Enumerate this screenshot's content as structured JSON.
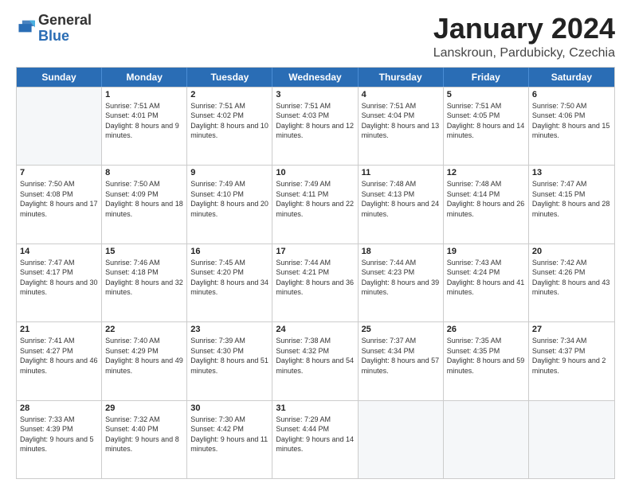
{
  "logo": {
    "general": "General",
    "blue": "Blue"
  },
  "header": {
    "title": "January 2024",
    "subtitle": "Lanskroun, Pardubicky, Czechia"
  },
  "weekdays": [
    "Sunday",
    "Monday",
    "Tuesday",
    "Wednesday",
    "Thursday",
    "Friday",
    "Saturday"
  ],
  "weeks": [
    [
      {
        "day": "",
        "sunrise": "",
        "sunset": "",
        "daylight": ""
      },
      {
        "day": "1",
        "sunrise": "Sunrise: 7:51 AM",
        "sunset": "Sunset: 4:01 PM",
        "daylight": "Daylight: 8 hours and 9 minutes."
      },
      {
        "day": "2",
        "sunrise": "Sunrise: 7:51 AM",
        "sunset": "Sunset: 4:02 PM",
        "daylight": "Daylight: 8 hours and 10 minutes."
      },
      {
        "day": "3",
        "sunrise": "Sunrise: 7:51 AM",
        "sunset": "Sunset: 4:03 PM",
        "daylight": "Daylight: 8 hours and 12 minutes."
      },
      {
        "day": "4",
        "sunrise": "Sunrise: 7:51 AM",
        "sunset": "Sunset: 4:04 PM",
        "daylight": "Daylight: 8 hours and 13 minutes."
      },
      {
        "day": "5",
        "sunrise": "Sunrise: 7:51 AM",
        "sunset": "Sunset: 4:05 PM",
        "daylight": "Daylight: 8 hours and 14 minutes."
      },
      {
        "day": "6",
        "sunrise": "Sunrise: 7:50 AM",
        "sunset": "Sunset: 4:06 PM",
        "daylight": "Daylight: 8 hours and 15 minutes."
      }
    ],
    [
      {
        "day": "7",
        "sunrise": "Sunrise: 7:50 AM",
        "sunset": "Sunset: 4:08 PM",
        "daylight": "Daylight: 8 hours and 17 minutes."
      },
      {
        "day": "8",
        "sunrise": "Sunrise: 7:50 AM",
        "sunset": "Sunset: 4:09 PM",
        "daylight": "Daylight: 8 hours and 18 minutes."
      },
      {
        "day": "9",
        "sunrise": "Sunrise: 7:49 AM",
        "sunset": "Sunset: 4:10 PM",
        "daylight": "Daylight: 8 hours and 20 minutes."
      },
      {
        "day": "10",
        "sunrise": "Sunrise: 7:49 AM",
        "sunset": "Sunset: 4:11 PM",
        "daylight": "Daylight: 8 hours and 22 minutes."
      },
      {
        "day": "11",
        "sunrise": "Sunrise: 7:48 AM",
        "sunset": "Sunset: 4:13 PM",
        "daylight": "Daylight: 8 hours and 24 minutes."
      },
      {
        "day": "12",
        "sunrise": "Sunrise: 7:48 AM",
        "sunset": "Sunset: 4:14 PM",
        "daylight": "Daylight: 8 hours and 26 minutes."
      },
      {
        "day": "13",
        "sunrise": "Sunrise: 7:47 AM",
        "sunset": "Sunset: 4:15 PM",
        "daylight": "Daylight: 8 hours and 28 minutes."
      }
    ],
    [
      {
        "day": "14",
        "sunrise": "Sunrise: 7:47 AM",
        "sunset": "Sunset: 4:17 PM",
        "daylight": "Daylight: 8 hours and 30 minutes."
      },
      {
        "day": "15",
        "sunrise": "Sunrise: 7:46 AM",
        "sunset": "Sunset: 4:18 PM",
        "daylight": "Daylight: 8 hours and 32 minutes."
      },
      {
        "day": "16",
        "sunrise": "Sunrise: 7:45 AM",
        "sunset": "Sunset: 4:20 PM",
        "daylight": "Daylight: 8 hours and 34 minutes."
      },
      {
        "day": "17",
        "sunrise": "Sunrise: 7:44 AM",
        "sunset": "Sunset: 4:21 PM",
        "daylight": "Daylight: 8 hours and 36 minutes."
      },
      {
        "day": "18",
        "sunrise": "Sunrise: 7:44 AM",
        "sunset": "Sunset: 4:23 PM",
        "daylight": "Daylight: 8 hours and 39 minutes."
      },
      {
        "day": "19",
        "sunrise": "Sunrise: 7:43 AM",
        "sunset": "Sunset: 4:24 PM",
        "daylight": "Daylight: 8 hours and 41 minutes."
      },
      {
        "day": "20",
        "sunrise": "Sunrise: 7:42 AM",
        "sunset": "Sunset: 4:26 PM",
        "daylight": "Daylight: 8 hours and 43 minutes."
      }
    ],
    [
      {
        "day": "21",
        "sunrise": "Sunrise: 7:41 AM",
        "sunset": "Sunset: 4:27 PM",
        "daylight": "Daylight: 8 hours and 46 minutes."
      },
      {
        "day": "22",
        "sunrise": "Sunrise: 7:40 AM",
        "sunset": "Sunset: 4:29 PM",
        "daylight": "Daylight: 8 hours and 49 minutes."
      },
      {
        "day": "23",
        "sunrise": "Sunrise: 7:39 AM",
        "sunset": "Sunset: 4:30 PM",
        "daylight": "Daylight: 8 hours and 51 minutes."
      },
      {
        "day": "24",
        "sunrise": "Sunrise: 7:38 AM",
        "sunset": "Sunset: 4:32 PM",
        "daylight": "Daylight: 8 hours and 54 minutes."
      },
      {
        "day": "25",
        "sunrise": "Sunrise: 7:37 AM",
        "sunset": "Sunset: 4:34 PM",
        "daylight": "Daylight: 8 hours and 57 minutes."
      },
      {
        "day": "26",
        "sunrise": "Sunrise: 7:35 AM",
        "sunset": "Sunset: 4:35 PM",
        "daylight": "Daylight: 8 hours and 59 minutes."
      },
      {
        "day": "27",
        "sunrise": "Sunrise: 7:34 AM",
        "sunset": "Sunset: 4:37 PM",
        "daylight": "Daylight: 9 hours and 2 minutes."
      }
    ],
    [
      {
        "day": "28",
        "sunrise": "Sunrise: 7:33 AM",
        "sunset": "Sunset: 4:39 PM",
        "daylight": "Daylight: 9 hours and 5 minutes."
      },
      {
        "day": "29",
        "sunrise": "Sunrise: 7:32 AM",
        "sunset": "Sunset: 4:40 PM",
        "daylight": "Daylight: 9 hours and 8 minutes."
      },
      {
        "day": "30",
        "sunrise": "Sunrise: 7:30 AM",
        "sunset": "Sunset: 4:42 PM",
        "daylight": "Daylight: 9 hours and 11 minutes."
      },
      {
        "day": "31",
        "sunrise": "Sunrise: 7:29 AM",
        "sunset": "Sunset: 4:44 PM",
        "daylight": "Daylight: 9 hours and 14 minutes."
      },
      {
        "day": "",
        "sunrise": "",
        "sunset": "",
        "daylight": ""
      },
      {
        "day": "",
        "sunrise": "",
        "sunset": "",
        "daylight": ""
      },
      {
        "day": "",
        "sunrise": "",
        "sunset": "",
        "daylight": ""
      }
    ]
  ]
}
